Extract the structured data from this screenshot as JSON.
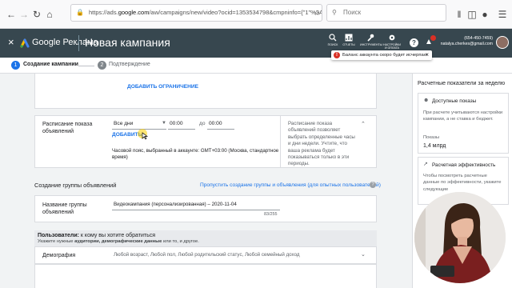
{
  "browser": {
    "url_prefix": "https://ads.",
    "url_domain": "google.com",
    "url_rest": "/aw/campaigns/new/video?ocid=1353534798&cmpninfo={\"1\"%3A4%2C",
    "search_placeholder": "Поиск"
  },
  "header": {
    "brand": "Google Реклама",
    "title": "Новая кампания",
    "tools": [
      {
        "label": "ПОИСК",
        "icon": "search-icon"
      },
      {
        "label": "ОТЧЕТЫ",
        "icon": "reports-icon"
      },
      {
        "label": "ИНСТРУМЕНТЫ",
        "icon": "tools-icon"
      },
      {
        "label": "НАСТРОЙКИ И ОПЛАТА",
        "icon": "settings-icon"
      }
    ],
    "account_id": "(654-450-7459)",
    "account_email": "natalya.cherkes@gmail.com"
  },
  "notice": {
    "text": "Баланс аккаунта скоро будет исчерпан",
    "close": "×"
  },
  "stepper": {
    "steps": [
      {
        "num": "1",
        "label": "Создание кампании"
      },
      {
        "num": "2",
        "label": "Подтверждение"
      }
    ]
  },
  "limits": {
    "add_link": "ДОБАВИТЬ ОГРАНИЧЕНИЕ"
  },
  "schedule": {
    "label": "Расписание показа объявлений",
    "day": "Все дни",
    "from_time": "00:00",
    "to_word": "до",
    "to_time": "00:00",
    "add_link": "ДОБАВИТЬ",
    "timezone": "Часовой пояс, выбранный в аккаунте: GMT+03:00 (Москва, стандартное время)",
    "help": "Расписание показа объявлений позволяет выбрать определенные часы и дни недели. Учтите, что ваша реклама будет показываться только в эти периоды."
  },
  "ad_group": {
    "heading": "Создание группы объявлений",
    "skip_link": "Пропустить создание группы и объявления (для опытных пользователей)",
    "name_label": "Название группы объявлений",
    "name_value": "Видеокампания (персонализированная) – 2020-11-04",
    "char_count": "83/255"
  },
  "users": {
    "title_bold": "Пользователи:",
    "title_rest": " к кому вы хотите обратиться",
    "sub_prefix": "Укажите нужные ",
    "sub_bold": "аудитории, демографические данные",
    "sub_suffix": " или то, и другое."
  },
  "demography": {
    "label": "Демография",
    "value": "Любой возраст, Любой пол, Любой родительский статус, Любой семейный доход"
  },
  "sidebar": {
    "title": "Расчетные показатели за неделю",
    "available_heading": "Доступные показы",
    "available_text": "При расчете учитываются настройки кампании, а не ставка и бюджет.",
    "impressions_label": "Показы",
    "impressions_value": "1,4 млрд",
    "efficiency_heading": "Расчетная эффективность",
    "efficiency_text": "Чтобы посмотреть расчетные данные по эффективности, укажите следующие"
  },
  "colors": {
    "header_bg": "#37474f",
    "accent_blue": "#1a73e8",
    "step_done": "#1a73e8",
    "warning_red": "#d93025"
  }
}
